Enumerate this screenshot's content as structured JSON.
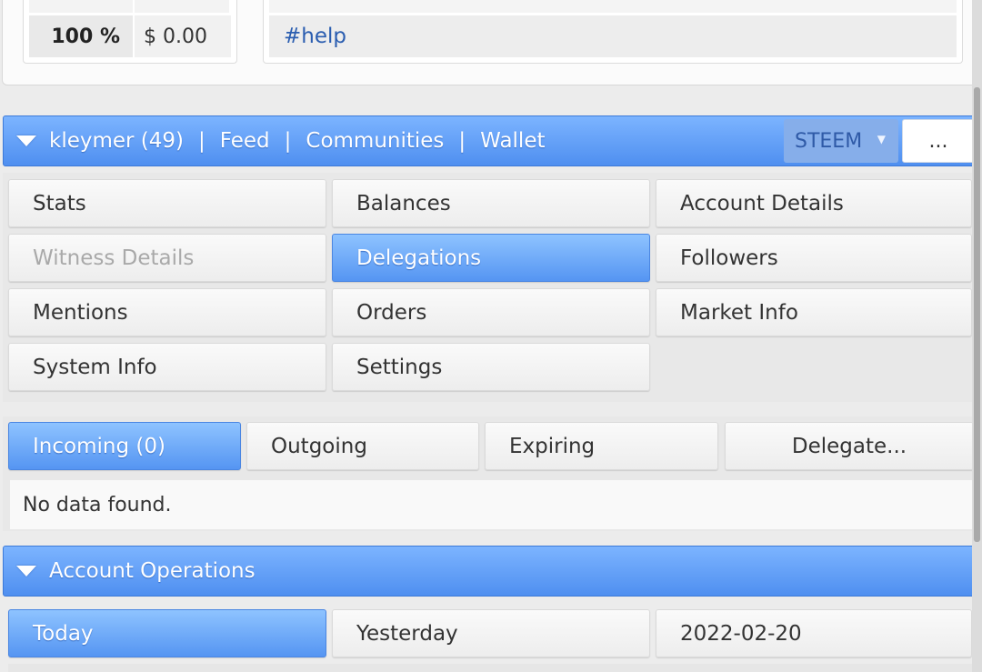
{
  "top": {
    "percent": "100 %",
    "usd": "$ 0.00",
    "tag": "#help"
  },
  "account_bar": {
    "user": "kleymer (49)",
    "nav": [
      "Feed",
      "Communities",
      "Wallet"
    ],
    "currency": "STEEM",
    "more": "..."
  },
  "account_tabs": [
    "Stats",
    "Balances",
    "Account Details",
    "Witness Details",
    "Delegations",
    "Followers",
    "Mentions",
    "Orders",
    "Market Info",
    "System Info",
    "Settings"
  ],
  "delegation_tabs": {
    "incoming": "Incoming (0)",
    "outgoing": "Outgoing",
    "expiring": "Expiring",
    "delegate": "Delegate..."
  },
  "no_data": "No data found.",
  "operations_bar": {
    "title": "Account Operations"
  },
  "operations_tabs": [
    "Today",
    "Yesterday",
    "2022-02-20"
  ],
  "colors": {
    "accent": "#5595f2",
    "link": "#2a5db0"
  }
}
